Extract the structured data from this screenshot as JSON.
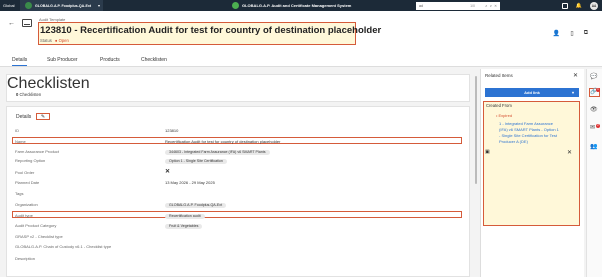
{
  "topbar": {
    "global_label": "Global",
    "org_name": "GLOBALG.A.P. Foodplus-QA-Ext",
    "app_title": "GLOBALG.A.P. Audit and Certificate Management System",
    "search_value": "ad",
    "search_count": "1/0",
    "avatar_initials": "AA"
  },
  "header": {
    "breadcrumb": "Audit Template",
    "title": "123810 - Recertification Audit for test for country of destination placeholder",
    "status_label": "Status",
    "status_value": "Open"
  },
  "tabs": [
    "Details",
    "Sub Producer",
    "Products",
    "Checklisten"
  ],
  "checklisten_card": {
    "title": "Checklisten",
    "count": "0",
    "count_label": "Checklisten"
  },
  "details": {
    "section_title": "Details",
    "rows": [
      {
        "label": "ID",
        "value": "123810",
        "type": "text"
      },
      {
        "label": "Name",
        "value": "Recertification Audit for test for country of destination placeholder",
        "type": "text"
      },
      {
        "label": "Farm Assurance Product",
        "value": "344603 - Integrated Farm Assurance (IFA) v6 SMART Plants",
        "type": "chip"
      },
      {
        "label": "Reporting Option",
        "value": "Option 1 - Single Site Certification",
        "type": "chip"
      },
      {
        "label": "Pool Order",
        "value": "✕",
        "type": "icon"
      },
      {
        "label": "Planned Date",
        "value": "13 May 2026 - 29 May 2025",
        "type": "text"
      },
      {
        "label": "Tags",
        "value": "",
        "type": "text"
      },
      {
        "label": "Organization",
        "value": "GLOBALG.A.P. Foodplus-QA-Ext",
        "type": "chip"
      },
      {
        "label": "Audit type",
        "value": "Recertification audit",
        "type": "chip"
      },
      {
        "label": "Audit Product Category",
        "value": "Fruit & Vegetables",
        "type": "chip"
      },
      {
        "label": "GRASP v2 - Checklist type",
        "value": "",
        "type": "text"
      },
      {
        "label": "GLOBALG.A.P. Chain of Custody v6.1 - Checklist type",
        "value": "",
        "type": "text"
      },
      {
        "label": "Description",
        "value": "",
        "type": "text"
      }
    ]
  },
  "related": {
    "title": "Related Items",
    "add_link": "Add link",
    "created_from": "Created From",
    "expired": "• Expired",
    "link_text": "1 - Integrated Farm Assurance (IFA) v6 SMART Plants - Option 1 - Single Site Certification for Test Producer A (DE)"
  },
  "rail": {
    "badge_1": "1",
    "badge_2": "2"
  },
  "colors": {
    "topbar": "#1c2a38",
    "accent": "#2c73d2",
    "highlight_border": "#d55b3a",
    "highlight_fill": "#fff8d9",
    "status_dot": "#d44a2c"
  }
}
